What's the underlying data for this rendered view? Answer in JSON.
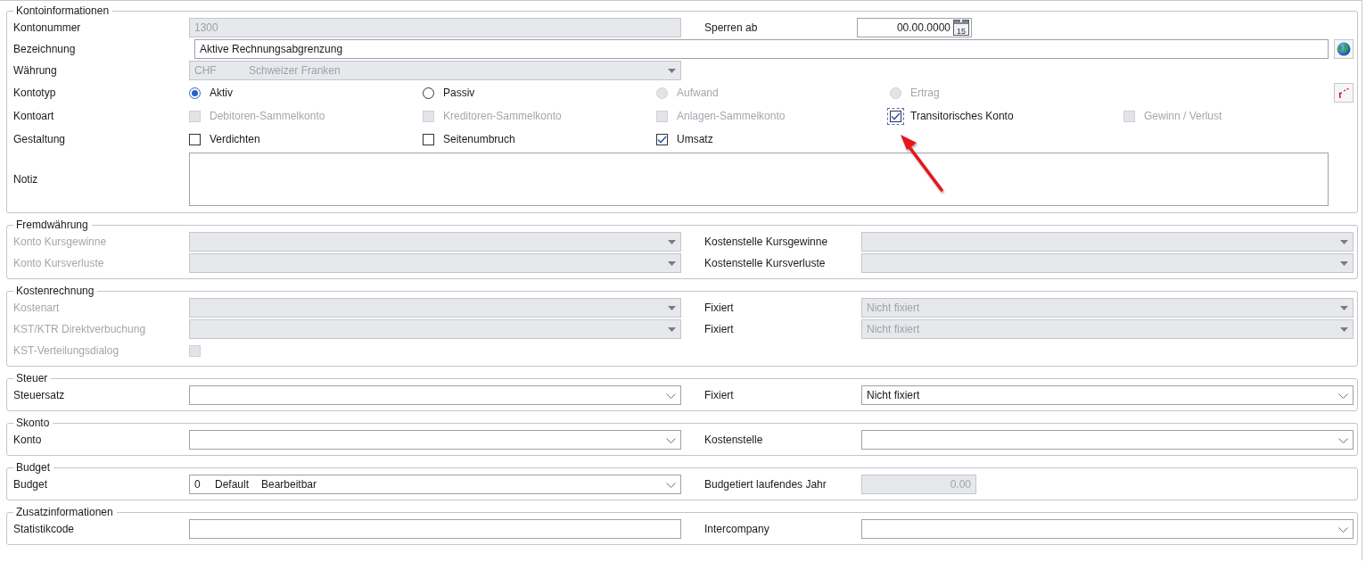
{
  "sections": [
    {
      "title": "Kontoinformationen",
      "rows": [
        {
          "kind": "pair",
          "left": {
            "label": {
              "text": "Kontonummer",
              "disabled": false
            },
            "control": {
              "kind": "text",
              "value": "1300",
              "disabled": true
            }
          },
          "right": {
            "label": {
              "text": "Sperren ab",
              "disabled": false
            },
            "control": {
              "kind": "date",
              "value": "00.00.0000",
              "disabled": false,
              "calendar_label": "15"
            }
          }
        },
        {
          "kind": "translatable",
          "label": {
            "text": "Bezeichnung",
            "disabled": false
          },
          "control": {
            "kind": "text",
            "value": "Aktive Rechnungsabgrenzung",
            "disabled": false
          }
        },
        {
          "kind": "pair",
          "left": {
            "label": {
              "text": "Währung",
              "disabled": false
            },
            "control": {
              "kind": "combo",
              "columns": [
                "CHF",
                "Schweizer Franken"
              ],
              "disabled": true
            }
          }
        },
        {
          "kind": "radio",
          "label": {
            "text": "Kontotyp",
            "disabled": false
          },
          "options": [
            {
              "label": "Aktiv",
              "selected": true,
              "disabled": false
            },
            {
              "label": "Passiv",
              "selected": false,
              "disabled": false
            },
            {
              "label": "Aufwand",
              "selected": false,
              "disabled": true
            },
            {
              "label": "Ertrag",
              "selected": false,
              "disabled": true
            }
          ]
        },
        {
          "kind": "checks",
          "label": {
            "text": "Kontoart",
            "disabled": false
          },
          "options": [
            {
              "label": "Debitoren-Sammelkonto",
              "checked": false,
              "disabled": true,
              "focused": false
            },
            {
              "label": "Kreditoren-Sammelkonto",
              "checked": false,
              "disabled": true,
              "focused": false
            },
            {
              "label": "Anlagen-Sammelkonto",
              "checked": false,
              "disabled": true,
              "focused": false
            },
            {
              "label": "Transitorisches Konto",
              "checked": true,
              "disabled": false,
              "focused": true
            },
            {
              "label": "Gewinn / Verlust",
              "checked": false,
              "disabled": true,
              "focused": false
            }
          ]
        },
        {
          "kind": "checks",
          "label": {
            "text": "Gestaltung",
            "disabled": false
          },
          "options": [
            {
              "label": "Verdichten",
              "checked": false,
              "disabled": false,
              "focused": false
            },
            {
              "label": "Seitenumbruch",
              "checked": false,
              "disabled": false,
              "focused": false
            },
            {
              "label": "Umsatz",
              "checked": true,
              "disabled": false,
              "focused": false
            }
          ]
        },
        {
          "kind": "note",
          "label": {
            "text": "Notiz",
            "disabled": false
          }
        }
      ]
    },
    {
      "title": "Fremdwährung",
      "rows": [
        {
          "kind": "pair",
          "left": {
            "label": {
              "text": "Konto Kursgewinne",
              "disabled": true
            },
            "control": {
              "kind": "combo",
              "disabled": true
            }
          },
          "right": {
            "label": {
              "text": "Kostenstelle Kursgewinne",
              "disabled": false
            },
            "control": {
              "kind": "combo",
              "disabled": true
            }
          }
        },
        {
          "kind": "pair",
          "left": {
            "label": {
              "text": "Konto Kursverluste",
              "disabled": true
            },
            "control": {
              "kind": "combo",
              "disabled": true
            }
          },
          "right": {
            "label": {
              "text": "Kostenstelle Kursverluste",
              "disabled": false
            },
            "control": {
              "kind": "combo",
              "disabled": true
            }
          }
        }
      ]
    },
    {
      "title": "Kostenrechnung",
      "rows": [
        {
          "kind": "pair",
          "left": {
            "label": {
              "text": "Kostenart",
              "disabled": true
            },
            "control": {
              "kind": "combo",
              "disabled": true
            }
          },
          "right": {
            "label": {
              "text": "Fixiert",
              "disabled": false
            },
            "control": {
              "kind": "combo",
              "columns": [
                "Nicht fixiert"
              ],
              "disabled": true
            }
          }
        },
        {
          "kind": "pair",
          "left": {
            "label": {
              "text": "KST/KTR Direktverbuchung",
              "disabled": true
            },
            "control": {
              "kind": "combo",
              "disabled": true
            }
          },
          "right": {
            "label": {
              "text": "Fixiert",
              "disabled": false
            },
            "control": {
              "kind": "combo",
              "columns": [
                "Nicht fixiert"
              ],
              "disabled": true
            }
          }
        },
        {
          "kind": "pair",
          "left": {
            "label": {
              "text": "KST-Verteilungsdialog",
              "disabled": true
            },
            "control": {
              "kind": "checkbox",
              "checked": false,
              "disabled": true
            }
          }
        }
      ]
    },
    {
      "title": "Steuer",
      "rows": [
        {
          "kind": "pair",
          "left": {
            "label": {
              "text": "Steuersatz",
              "disabled": false
            },
            "control": {
              "kind": "combo",
              "disabled": false
            }
          },
          "right": {
            "label": {
              "text": "Fixiert",
              "disabled": false
            },
            "control": {
              "kind": "combo",
              "columns": [
                "Nicht fixiert"
              ],
              "disabled": false
            }
          }
        }
      ]
    },
    {
      "title": "Skonto",
      "rows": [
        {
          "kind": "pair",
          "left": {
            "label": {
              "text": "Konto",
              "disabled": false
            },
            "control": {
              "kind": "combo",
              "disabled": false
            }
          },
          "right": {
            "label": {
              "text": "Kostenstelle",
              "disabled": false
            },
            "control": {
              "kind": "combo",
              "disabled": false
            }
          }
        }
      ]
    },
    {
      "title": "Budget",
      "rows": [
        {
          "kind": "pair",
          "left": {
            "label": {
              "text": "Budget",
              "disabled": false
            },
            "control": {
              "kind": "combo",
              "columns": [
                "0",
                "Default",
                "Bearbeitbar"
              ],
              "disabled": false
            }
          },
          "right": {
            "label": {
              "text": "Budgetiert laufendes Jahr",
              "disabled": false
            },
            "control": {
              "kind": "number",
              "value": "0.00",
              "disabled": true
            }
          }
        }
      ]
    },
    {
      "title": "Zusatzinformationen",
      "rows": [
        {
          "kind": "pair",
          "left": {
            "label": {
              "text": "Statistikcode",
              "disabled": false
            },
            "control": {
              "kind": "text",
              "disabled": false
            }
          },
          "right": {
            "label": {
              "text": "Intercompany",
              "disabled": false
            },
            "control": {
              "kind": "combo",
              "disabled": false
            }
          }
        }
      ]
    }
  ]
}
